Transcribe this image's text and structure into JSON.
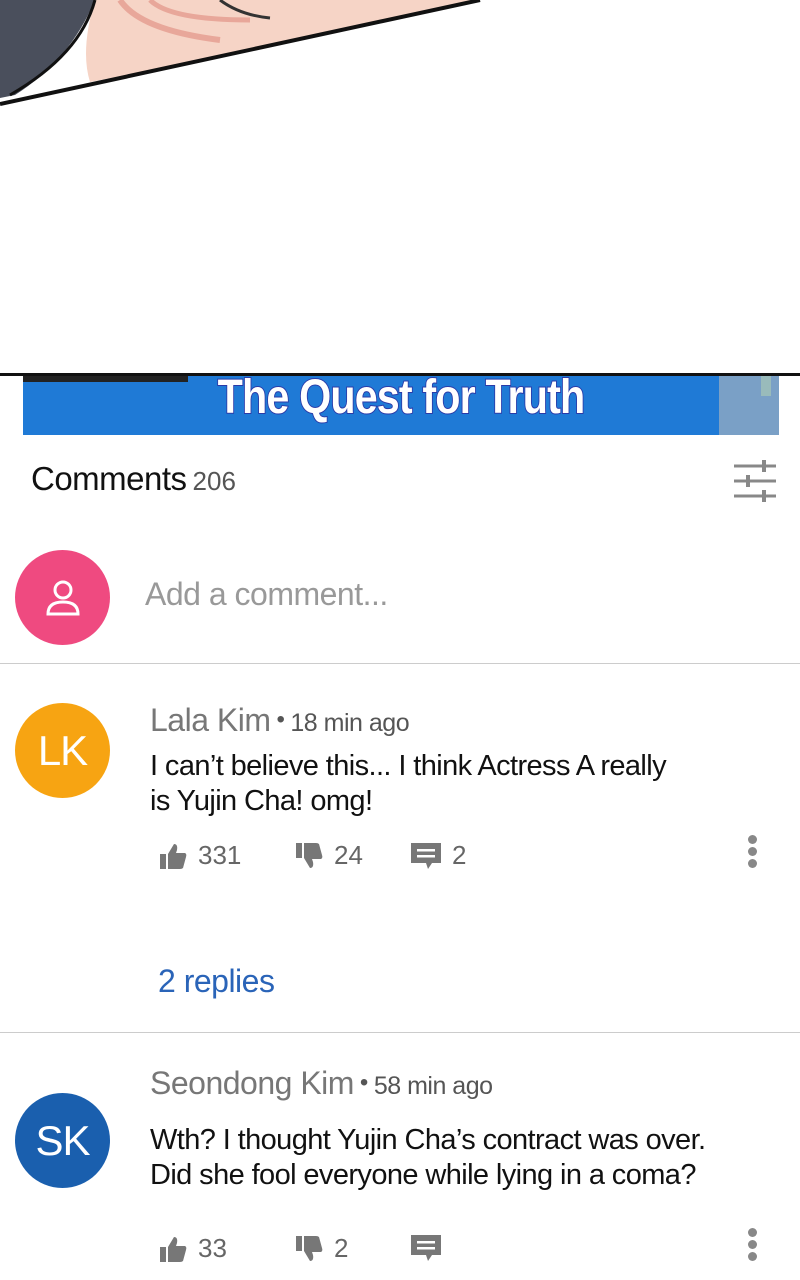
{
  "video": {
    "title": "The Quest for Truth"
  },
  "comments_header": {
    "title": "Comments",
    "count": "206"
  },
  "add_comment": {
    "placeholder": "Add a comment..."
  },
  "comments": [
    {
      "initials": "LK",
      "avatar_color": "#f7a412",
      "author": "Lala Kim",
      "time": "18 min ago",
      "text_line1": "I can’t believe this... I think Actress A really",
      "text_line2": "is Yujin Cha! omg!",
      "likes": "331",
      "dislikes": "24",
      "reply_count": "2",
      "replies_label": "2 replies"
    },
    {
      "initials": "SK",
      "avatar_color": "#1a5fae",
      "author": "Seondong Kim",
      "time": "58 min ago",
      "text_line1": "Wth? I thought Yujin Cha’s contract was over.",
      "text_line2": "Did she fool everyone while lying in a coma?",
      "likes": "33",
      "dislikes": "2"
    }
  ],
  "colors": {
    "accent": "#2a64b8",
    "user_avatar": "#ef4a80",
    "banner": "#1f7ad6"
  }
}
